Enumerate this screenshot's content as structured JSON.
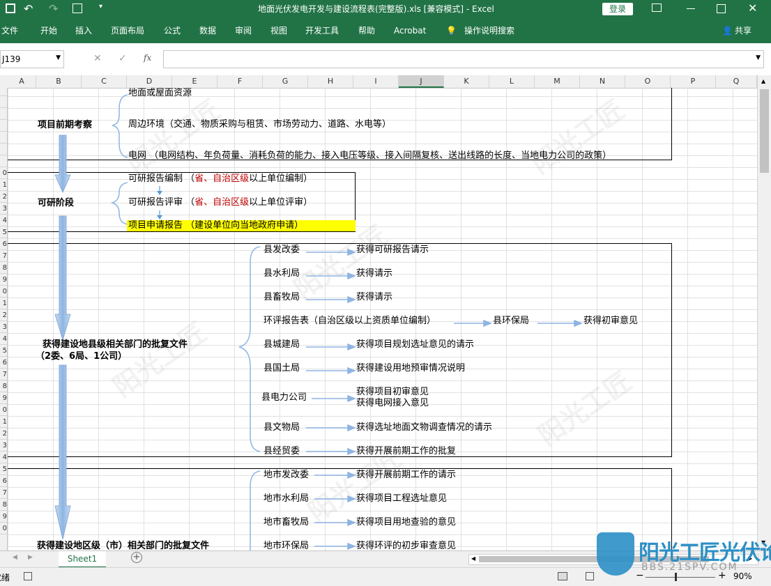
{
  "window": {
    "title": "地面光伏发电开发与建设流程表(完整版).xls  [兼容模式]  -  Excel",
    "login_label": "登录"
  },
  "ribbon": {
    "tabs": [
      "文件",
      "开始",
      "插入",
      "页面布局",
      "公式",
      "数据",
      "审阅",
      "视图",
      "开发工具",
      "帮助",
      "Acrobat"
    ],
    "tell_me": "操作说明搜索",
    "share": "共享"
  },
  "formula_bar": {
    "name_box": "J139",
    "cancel": "✕",
    "enter": "✓",
    "fx": "fx",
    "content": ""
  },
  "columns": [
    "A",
    "B",
    "C",
    "D",
    "E",
    "F",
    "G",
    "H",
    "I",
    "J",
    "K",
    "L",
    "M",
    "N",
    "O",
    "P",
    "Q"
  ],
  "rows": [
    "",
    "",
    "",
    "",
    "",
    "",
    "",
    "0",
    "1",
    "2",
    "3",
    "4",
    "5",
    "6",
    "7",
    "8",
    "9",
    "0",
    "1",
    "2",
    "3",
    "4",
    "5",
    "6",
    "7",
    "8",
    "9",
    "0",
    "1",
    "2",
    "3",
    "4",
    "5",
    "6",
    "7",
    "8",
    "9",
    "0"
  ],
  "sheet": {
    "stage1": {
      "title": "项目前期考察",
      "items": [
        "地面或屋面资源",
        "周边环境（交通、物质采购与租赁、市场劳动力、道路、水电等）",
        "电网      （电网结构、年负荷量、消耗负荷的能力、接入电压等级、接入间隔复核、送出线路的长度、当地电力公司的政策）"
      ]
    },
    "stage2": {
      "title": "可研阶段",
      "items": [
        {
          "a": "可研报告编制  （",
          "red": "省、自治区级",
          "b": "以上单位编制）"
        },
        {
          "a": "可研报告评审  （",
          "red": "省、自治区级",
          "b": "以上单位评审）"
        },
        {
          "a": "项目申请报告  （建设单位向当地政府申请）",
          "red": "",
          "b": ""
        }
      ]
    },
    "stage3": {
      "title": "获得建设地县级相关部门的批复文件",
      "subtitle": "（2委、6局、1公司）",
      "rows": [
        {
          "dept": "县发改委",
          "result": "获得可研报告请示"
        },
        {
          "dept": "县水利局",
          "result": "获得请示"
        },
        {
          "dept": "县畜牧局",
          "result": "获得请示"
        },
        {
          "dept": "环评报告表（自治区级以上资质单位编制）",
          "mid": "县环保局",
          "result": "获得初审意见"
        },
        {
          "dept": "县城建局",
          "result": "获得项目规划选址意见的请示"
        },
        {
          "dept": "县国土局",
          "result": "获得建设用地预审情况说明"
        },
        {
          "dept": "县电力公司",
          "result": "获得项目初审意见",
          "result2": "获得电网接入意见"
        },
        {
          "dept": "县文物局",
          "result": "获得选址地面文物调查情况的请示"
        },
        {
          "dept": "县经贸委",
          "result": "获得开展前期工作的批复"
        }
      ]
    },
    "stage4": {
      "title": "获得建设地区级（市）相关部门的批复文件",
      "rows": [
        {
          "dept": "地市发改委",
          "result": "获得开展前期工作的请示"
        },
        {
          "dept": "地市水利局",
          "result": "获得项目工程选址意见"
        },
        {
          "dept": "地市畜牧局",
          "result": "获得项目用地查验的意见"
        },
        {
          "dept": "地市环保局",
          "result": "获得环评的初步审查意见"
        }
      ]
    }
  },
  "sheet_tabs": {
    "active": "Sheet1",
    "add": "+"
  },
  "status": {
    "mode": "就绪",
    "zoom": "90%"
  },
  "watermark": {
    "text": "阳光工匠光伏论坛",
    "url": "BBS.21SPV.COM"
  },
  "colors": {
    "excel_green": "#217346",
    "highlight": "#ffff00",
    "arrow": "#9dc3e6"
  }
}
